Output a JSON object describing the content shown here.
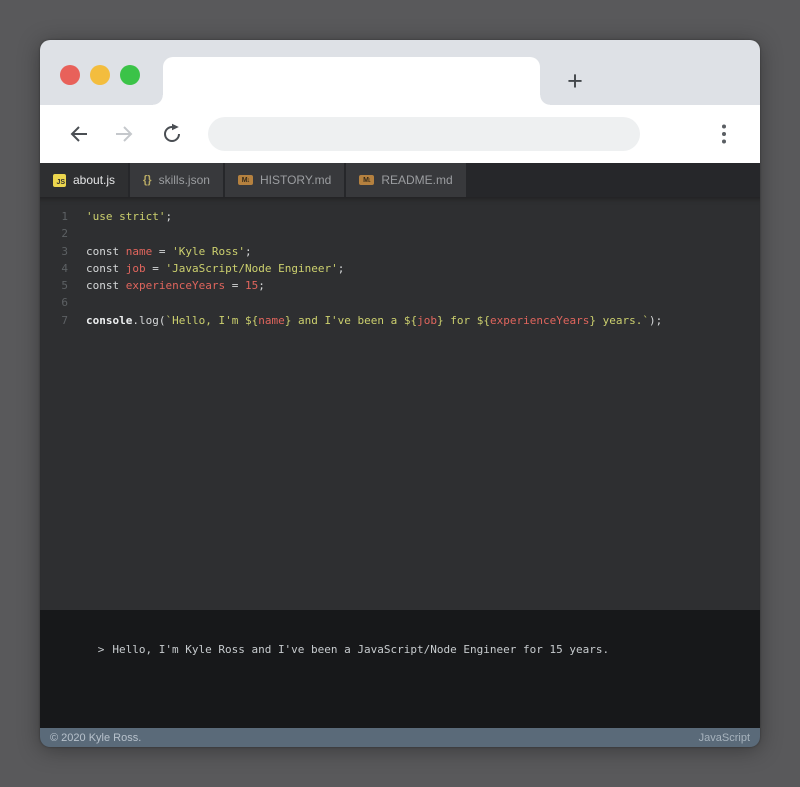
{
  "page": {
    "background": "#59595b"
  },
  "browser": {
    "new_tab_label": "+",
    "traffic_lights": [
      "#e8615a",
      "#f3bd3e",
      "#3bc348"
    ],
    "chrome_color": "#dee1e6",
    "urlbar_value": "",
    "urlbar_placeholder": ""
  },
  "editor": {
    "background": "#2e2f31",
    "icon_glyphs": {
      "js": "JS",
      "json": "{}",
      "md": "M↓"
    },
    "tabs": [
      {
        "label": "about.js",
        "icon": "js",
        "active": true
      },
      {
        "label": "skills.json",
        "icon": "json",
        "active": false
      },
      {
        "label": "HISTORY.md",
        "icon": "md",
        "active": false
      },
      {
        "label": "README.md",
        "icon": "md",
        "active": false
      }
    ],
    "syntax_colors": {
      "plain": "#d5d7d8",
      "string": "#ccd06e",
      "variable": "#e0655d",
      "number": "#e0655d",
      "builtin": "#eceeef"
    },
    "code_lines": [
      {
        "n": "1",
        "tokens": [
          [
            "string",
            "'use strict'"
          ],
          [
            "plain",
            ";"
          ]
        ]
      },
      {
        "n": "2",
        "tokens": []
      },
      {
        "n": "3",
        "tokens": [
          [
            "plain",
            "const "
          ],
          [
            "variable",
            "name"
          ],
          [
            "plain",
            " = "
          ],
          [
            "string",
            "'Kyle Ross'"
          ],
          [
            "plain",
            ";"
          ]
        ]
      },
      {
        "n": "4",
        "tokens": [
          [
            "plain",
            "const "
          ],
          [
            "variable",
            "job"
          ],
          [
            "plain",
            " = "
          ],
          [
            "string",
            "'JavaScript/Node Engineer'"
          ],
          [
            "plain",
            ";"
          ]
        ]
      },
      {
        "n": "5",
        "tokens": [
          [
            "plain",
            "const "
          ],
          [
            "variable",
            "experienceYears"
          ],
          [
            "plain",
            " = "
          ],
          [
            "number",
            "15"
          ],
          [
            "plain",
            ";"
          ]
        ]
      },
      {
        "n": "6",
        "tokens": []
      },
      {
        "n": "7",
        "tokens": [
          [
            "builtin",
            "console"
          ],
          [
            "plain",
            "."
          ],
          [
            "plain",
            "log"
          ],
          [
            "plain",
            "("
          ],
          [
            "string",
            "`Hello, I'm ${"
          ],
          [
            "variable",
            "name"
          ],
          [
            "string",
            "} and I've been a ${"
          ],
          [
            "variable",
            "job"
          ],
          [
            "string",
            "} for ${"
          ],
          [
            "variable",
            "experienceYears"
          ],
          [
            "string",
            "} years.`"
          ],
          [
            "plain",
            ");"
          ]
        ]
      }
    ]
  },
  "console": {
    "prompt": ">",
    "message": "Hello, I'm Kyle Ross and I've been a JavaScript/Node Engineer for 15 years.",
    "background": "#17181a"
  },
  "statusbar": {
    "left": "© 2020 Kyle Ross.",
    "right": "JavaScript",
    "background": "#5a6a79"
  }
}
